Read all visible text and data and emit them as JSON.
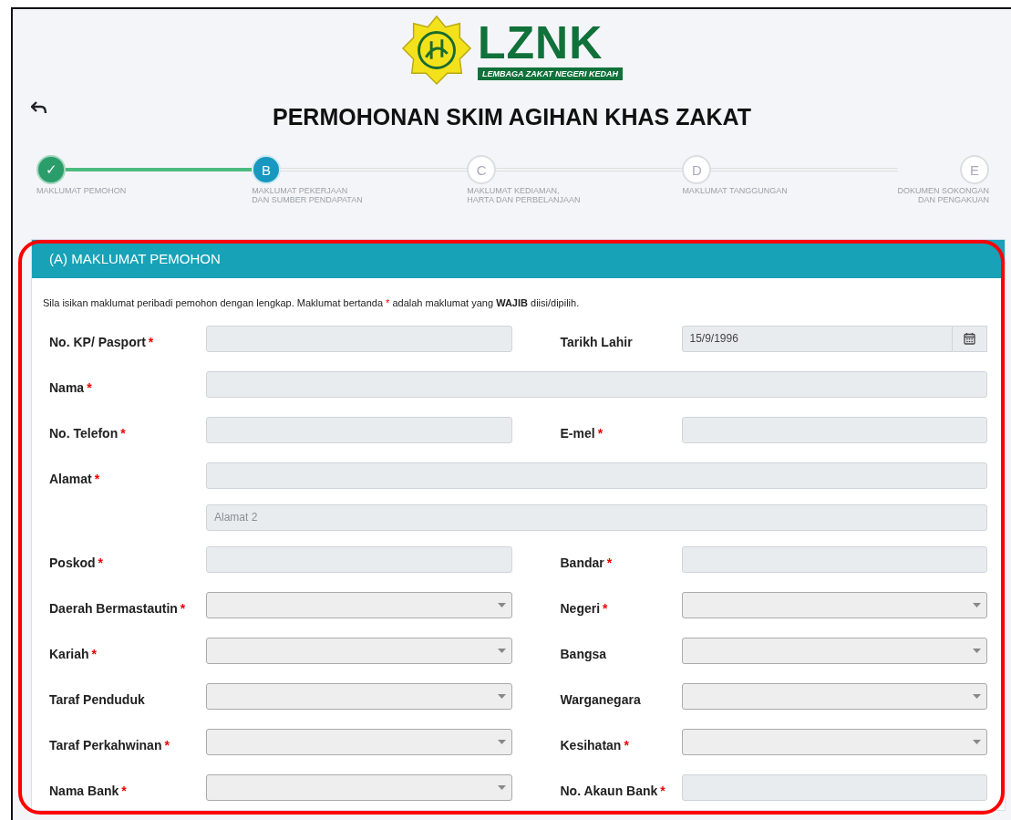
{
  "logo": {
    "brand": "LZNK",
    "tagline": "LEMBAGA ZAKAT NEGERI KEDAH"
  },
  "title": "PERMOHONAN SKIM AGIHAN KHAS ZAKAT",
  "steps": [
    {
      "symbol": "✓",
      "label": "MAKLUMAT PEMOHON",
      "completed": true,
      "selected": false
    },
    {
      "symbol": "B",
      "label": "MAKLUMAT PEKERJAAN\nDAN SUMBER PENDAPATAN",
      "completed": false,
      "selected": true
    },
    {
      "symbol": "C",
      "label": "MAKLUMAT KEDIAMAN,\nHARTA DAN PERBELANJAAN",
      "completed": false,
      "selected": false
    },
    {
      "symbol": "D",
      "label": "MAKLUMAT TANGGUNGAN",
      "completed": false,
      "selected": false
    },
    {
      "symbol": "E",
      "label": "DOKUMEN SOKONGAN\nDAN PENGAKUAN",
      "completed": false,
      "selected": false
    }
  ],
  "panel": {
    "title": "(A) MAKLUMAT PEMOHON",
    "intro": {
      "before": "Sila isikan maklumat peribadi pemohon dengan lengkap. Maklumat bertanda",
      "mark": "*",
      "after": "adalah maklumat yang **WAJIB** diisi/dipilih."
    },
    "rows": [
      {
        "cells": [
          {
            "label": "No. KP/ Pasport",
            "mark": "*",
            "kind": "text"
          },
          {
            "label": "Tarikh Lahir",
            "kind": "date",
            "value": "15/9/1996"
          }
        ]
      },
      {
        "cells": [
          {
            "label": "Nama",
            "mark": "*",
            "kind": "text"
          }
        ]
      },
      {
        "cells": [
          {
            "label": "No. Telefon",
            "mark": "*",
            "kind": "text"
          },
          {
            "label": "E-mel",
            "mark": "*",
            "kind": "text"
          }
        ]
      },
      {
        "cells": [
          {
            "label": "Alamat",
            "mark": "*",
            "kind": "text"
          }
        ]
      },
      {
        "cells": [
          {
            "kind": "text",
            "placeholder": "Alamat 2"
          }
        ]
      },
      {
        "cells": [
          {
            "label": "Poskod",
            "mark": "*",
            "kind": "text"
          },
          {
            "label": "Bandar",
            "mark": "*",
            "kind": "text"
          }
        ]
      },
      {
        "cells": [
          {
            "label": "Daerah Bermastautin",
            "mark": "*",
            "kind": "select"
          },
          {
            "label": "Negeri",
            "mark": "*",
            "kind": "select"
          }
        ]
      },
      {
        "cells": [
          {
            "label": "Kariah",
            "mark": "*",
            "kind": "select"
          },
          {
            "label": "Bangsa",
            "kind": "select"
          }
        ]
      },
      {
        "cells": [
          {
            "label": "Taraf Penduduk",
            "kind": "select"
          },
          {
            "label": "Warganegara",
            "kind": "select"
          }
        ]
      },
      {
        "cells": [
          {
            "label": "Taraf Perkahwinan",
            "mark": "*",
            "kind": "select"
          },
          {
            "label": "Kesihatan",
            "mark": "*",
            "kind": "select"
          }
        ]
      },
      {
        "cells": [
          {
            "label": "Nama Bank",
            "mark": "*",
            "kind": "select"
          },
          {
            "label": "No. Akaun Bank",
            "mark": "*",
            "kind": "text"
          }
        ]
      }
    ]
  }
}
